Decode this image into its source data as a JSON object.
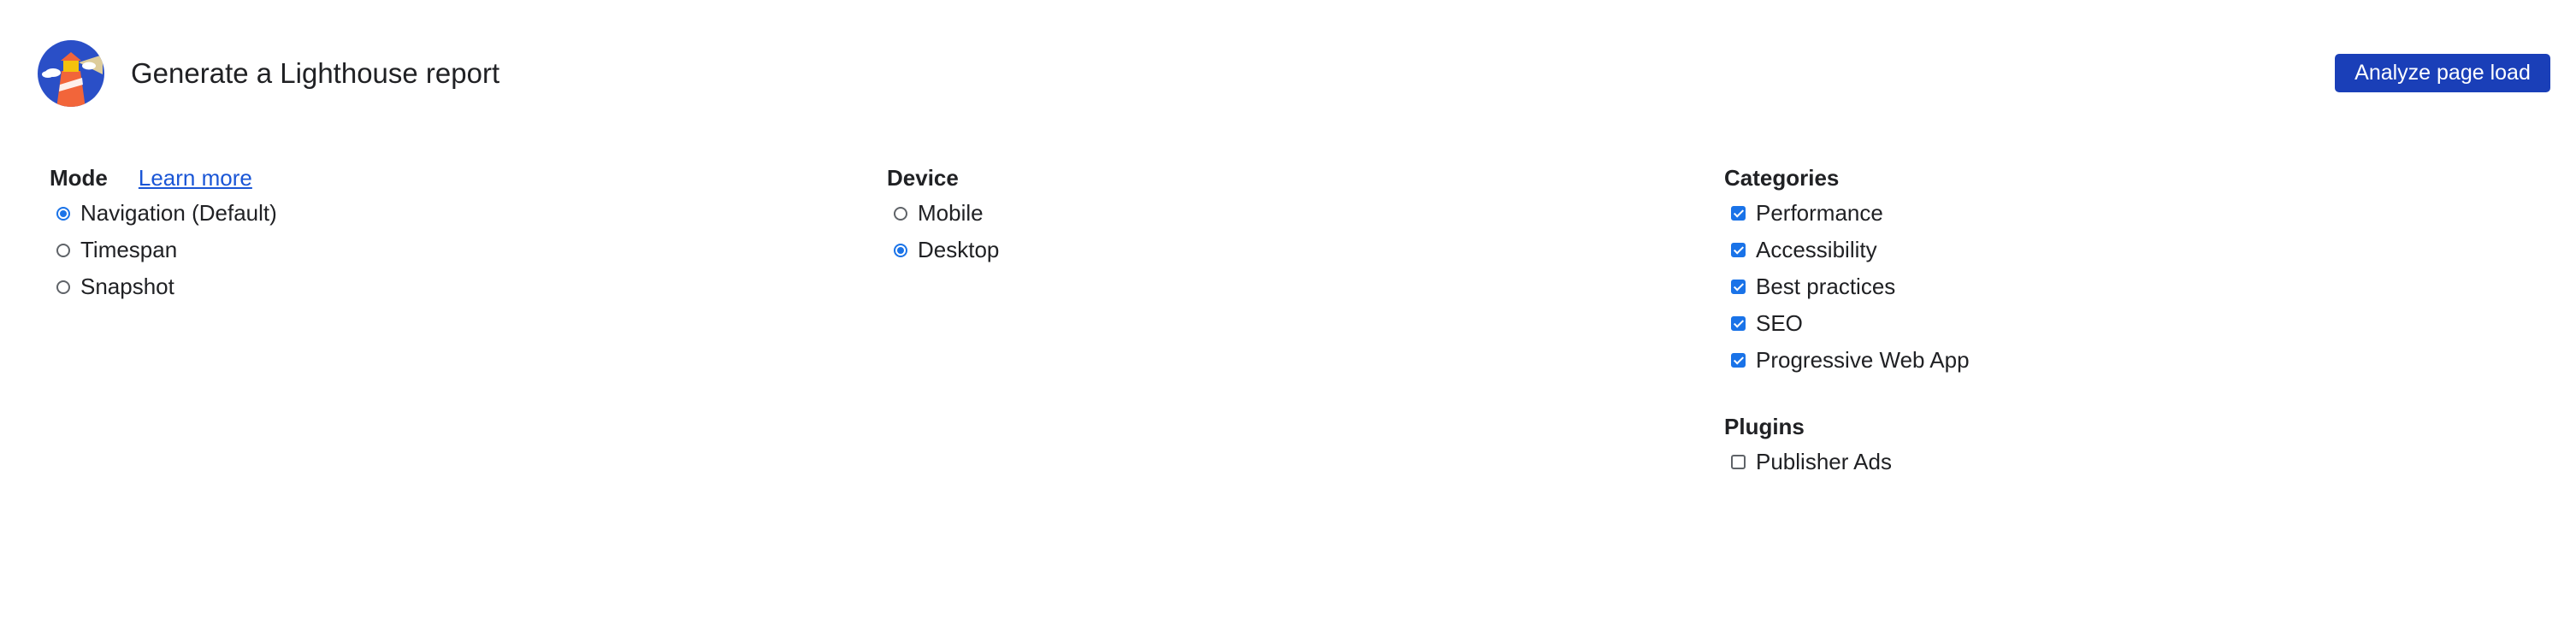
{
  "header": {
    "title": "Generate a Lighthouse report",
    "analyze_label": "Analyze page load",
    "logo_icon": "lighthouse-logo-icon"
  },
  "mode": {
    "title": "Mode",
    "learn_more": "Learn more",
    "options": [
      {
        "label": "Navigation (Default)",
        "checked": true
      },
      {
        "label": "Timespan",
        "checked": false
      },
      {
        "label": "Snapshot",
        "checked": false
      }
    ]
  },
  "device": {
    "title": "Device",
    "options": [
      {
        "label": "Mobile",
        "checked": false
      },
      {
        "label": "Desktop",
        "checked": true
      }
    ]
  },
  "categories": {
    "title": "Categories",
    "items": [
      {
        "label": "Performance",
        "checked": true
      },
      {
        "label": "Accessibility",
        "checked": true
      },
      {
        "label": "Best practices",
        "checked": true
      },
      {
        "label": "SEO",
        "checked": true
      },
      {
        "label": "Progressive Web App",
        "checked": true
      }
    ]
  },
  "plugins": {
    "title": "Plugins",
    "items": [
      {
        "label": "Publisher Ads",
        "checked": false
      }
    ]
  },
  "colors": {
    "accent": "#1a73e8",
    "button": "#1a3fb8",
    "link": "#1a56d6"
  }
}
